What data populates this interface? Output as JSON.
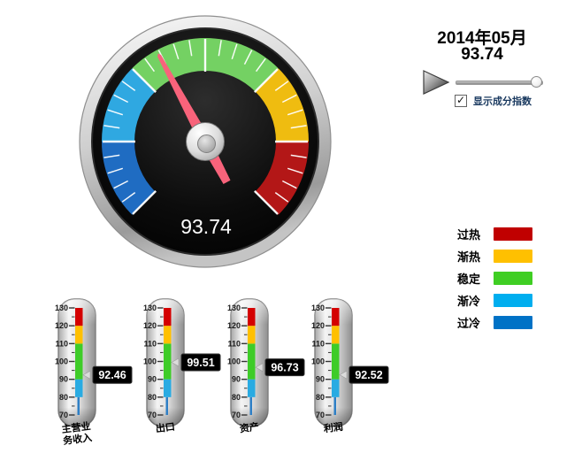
{
  "controls": {
    "period_label": "2014年05月",
    "period_value": "93.74",
    "play_button": "play",
    "slider_position": 0.93,
    "checkbox": {
      "checked": true,
      "check_glyph": "✓",
      "label": "显示成分指数",
      "label_color": "#17375E"
    }
  },
  "legend": {
    "items": [
      {
        "label": "过热",
        "color": "#C00000"
      },
      {
        "label": "渐热",
        "color": "#FFC000"
      },
      {
        "label": "稳定",
        "color": "#3FCE23"
      },
      {
        "label": "渐冷",
        "color": "#00AEEF"
      },
      {
        "label": "过冷",
        "color": "#0072C6"
      }
    ]
  },
  "chart_data": [
    {
      "type": "gauge",
      "value": 93.74,
      "value_label": "93.74",
      "min": 70,
      "max": 130,
      "start_angle": 225,
      "sweep": 270,
      "tick_minor_step": 2,
      "tick_major_step": 10,
      "needle_color": "#F8637B",
      "face_color": "#0a0a0a",
      "zones": [
        {
          "label": "过冷",
          "from": 70,
          "to": 80,
          "color": "#1F6CC2"
        },
        {
          "label": "渐冷",
          "from": 80,
          "to": 90,
          "color": "#2FA8E1"
        },
        {
          "label": "稳定",
          "from": 90,
          "to": 110,
          "color": "#74D163"
        },
        {
          "label": "渐热",
          "from": 110,
          "to": 120,
          "color": "#EFBC10"
        },
        {
          "label": "过热",
          "from": 120,
          "to": 130,
          "color": "#B31717"
        }
      ]
    },
    {
      "type": "thermometer",
      "min": 70,
      "max": 130,
      "tick_major_step": 10,
      "tick_minor_step": 5,
      "zones": [
        {
          "from": 70,
          "to": 80,
          "color": "#2E7FC6",
          "thin": true
        },
        {
          "from": 80,
          "to": 90,
          "color": "#29ABE2"
        },
        {
          "from": 90,
          "to": 110,
          "color": "#3ECC28"
        },
        {
          "from": 110,
          "to": 120,
          "color": "#FFC000"
        },
        {
          "from": 120,
          "to": 130,
          "color": "#D40000"
        }
      ],
      "items": [
        {
          "label": "主营业\n务收入",
          "value": 92.46,
          "value_label": "92.46"
        },
        {
          "label": "出口",
          "value": 99.51,
          "value_label": "99.51"
        },
        {
          "label": "资产",
          "value": 96.73,
          "value_label": "96.73"
        },
        {
          "label": "利润",
          "value": 92.52,
          "value_label": "92.52"
        }
      ]
    }
  ]
}
